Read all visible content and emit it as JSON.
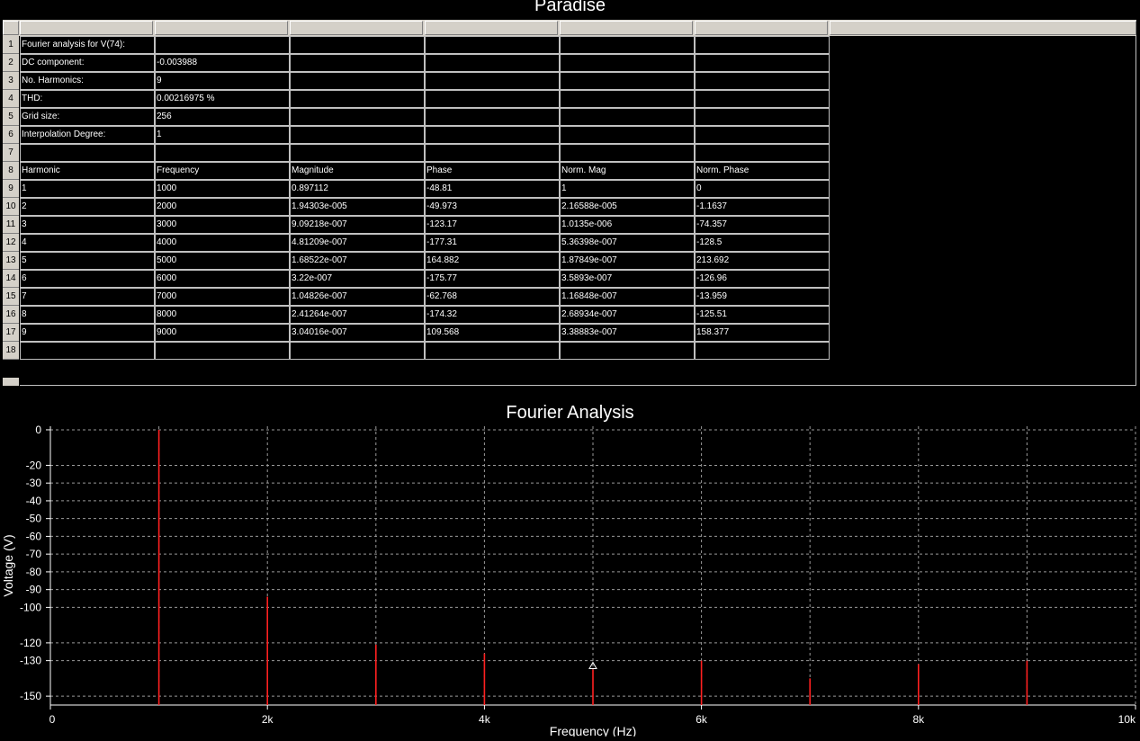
{
  "sheet_title": "Paradise",
  "spreadsheet": {
    "columns": 6,
    "row_numbers": [
      "1",
      "2",
      "3",
      "4",
      "5",
      "6",
      "7",
      "8",
      "9",
      "10",
      "11",
      "12",
      "13",
      "14",
      "15",
      "16",
      "17",
      "18"
    ],
    "rows": [
      [
        "Fourier analysis for V(74):",
        "",
        "",
        "",
        "",
        ""
      ],
      [
        "DC component:",
        "-0.003988",
        "",
        "",
        "",
        ""
      ],
      [
        "No. Harmonics:",
        "9",
        "",
        "",
        "",
        ""
      ],
      [
        "THD:",
        "0.00216975 %",
        "",
        "",
        "",
        ""
      ],
      [
        "Grid size:",
        "256",
        "",
        "",
        "",
        ""
      ],
      [
        "Interpolation Degree:",
        "1",
        "",
        "",
        "",
        ""
      ],
      [
        "",
        "",
        "",
        "",
        "",
        ""
      ],
      [
        "Harmonic",
        "Frequency",
        "Magnitude",
        "Phase",
        "Norm. Mag",
        "Norm. Phase"
      ],
      [
        "1",
        "1000",
        "0.897112",
        "-48.81",
        "1",
        "0"
      ],
      [
        "2",
        "2000",
        "1.94303e-005",
        "-49.973",
        "2.16588e-005",
        "-1.1637"
      ],
      [
        "3",
        "3000",
        "9.09218e-007",
        "-123.17",
        "1.0135e-006",
        "-74.357"
      ],
      [
        "4",
        "4000",
        "4.81209e-007",
        "-177.31",
        "5.36398e-007",
        "-128.5"
      ],
      [
        "5",
        "5000",
        "1.68522e-007",
        "164.882",
        "1.87849e-007",
        "213.692"
      ],
      [
        "6",
        "6000",
        "3.22e-007",
        "-175.77",
        "3.5893e-007",
        "-126.96"
      ],
      [
        "7",
        "7000",
        "1.04826e-007",
        "-62.768",
        "1.16848e-007",
        "-13.959"
      ],
      [
        "8",
        "8000",
        "2.41264e-007",
        "-174.32",
        "2.68934e-007",
        "-125.51"
      ],
      [
        "9",
        "9000",
        "3.04016e-007",
        "109.568",
        "3.38883e-007",
        "158.377"
      ],
      [
        "",
        "",
        "",
        "",
        "",
        ""
      ]
    ]
  },
  "chart_data": {
    "type": "bar",
    "title": "Fourier Analysis",
    "ylabel": "Voltage (V)",
    "xlabel": "Frequency (Hz)",
    "x_tick_labels": [
      "0",
      "2k",
      "4k",
      "6k",
      "8k",
      "10k"
    ],
    "y_tick_labels": [
      "0",
      "-20",
      "-30",
      "-40",
      "-50",
      "-60",
      "-70",
      "-80",
      "-90",
      "-100",
      "-120",
      "-130",
      "-150"
    ],
    "y_tick_values": [
      0,
      -20,
      -30,
      -40,
      -50,
      -60,
      -70,
      -80,
      -90,
      -100,
      -120,
      -130,
      -150
    ],
    "xlim": [
      0,
      10000
    ],
    "ylim": [
      -155,
      2
    ],
    "grid": true,
    "background": "#000000",
    "grid_color": "#9a9a9a",
    "bar_color": "#ff2020",
    "text_color": "#ffffff",
    "x": [
      1000,
      2000,
      3000,
      4000,
      5000,
      6000,
      7000,
      8000,
      9000
    ],
    "values": [
      0,
      -94,
      -121,
      -126,
      -135,
      -130,
      -140,
      -132,
      -130
    ],
    "marker": {
      "x": 5000,
      "y": -133,
      "symbol": "triangle"
    }
  }
}
